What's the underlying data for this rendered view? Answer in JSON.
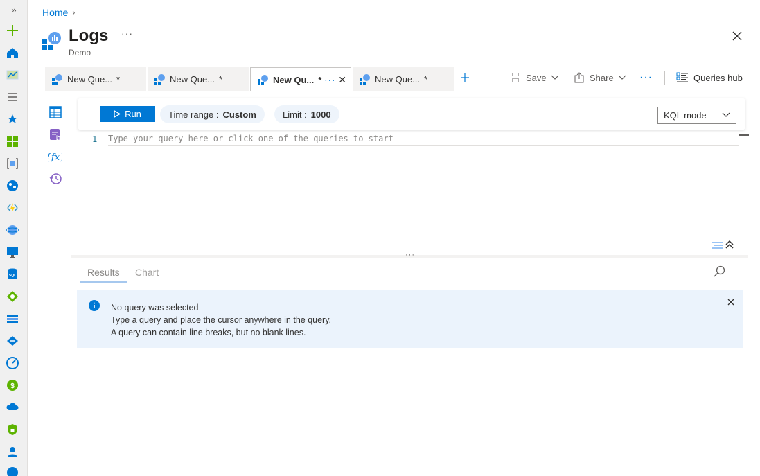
{
  "breadcrumb": {
    "home": "Home",
    "separator": "›"
  },
  "header": {
    "title": "Logs",
    "subtitle": "Demo",
    "more": "···"
  },
  "tabs": [
    {
      "label": "New Que...",
      "star": "*"
    },
    {
      "label": "New Que...",
      "star": "*"
    },
    {
      "label": "New Qu...",
      "star": "*",
      "dots": "···",
      "close": "✕",
      "active": true
    },
    {
      "label": "New Que...",
      "star": "*"
    }
  ],
  "toolbar": {
    "save_label": "Save",
    "share_label": "Share",
    "more": "···",
    "queries_hub_label": "Queries hub"
  },
  "querybar": {
    "run_label": "Run",
    "time_range_label": "Time range :",
    "time_range_value": "Custom",
    "limit_label": "Limit :",
    "limit_value": "1000",
    "mode_value": "KQL mode"
  },
  "editor": {
    "line_number": "1",
    "placeholder": "Type your query here or click one of the queries to start",
    "splitter_grip": "···"
  },
  "results": {
    "tab_results": "Results",
    "tab_chart": "Chart"
  },
  "info": {
    "line1": "No query was selected",
    "line2": "Type a query and place the cursor anywhere in the query.",
    "line3": "A query can contain line breaks, but no blank lines."
  },
  "colors": {
    "accent": "#0078d4",
    "info_bg": "#ebf3fc"
  }
}
